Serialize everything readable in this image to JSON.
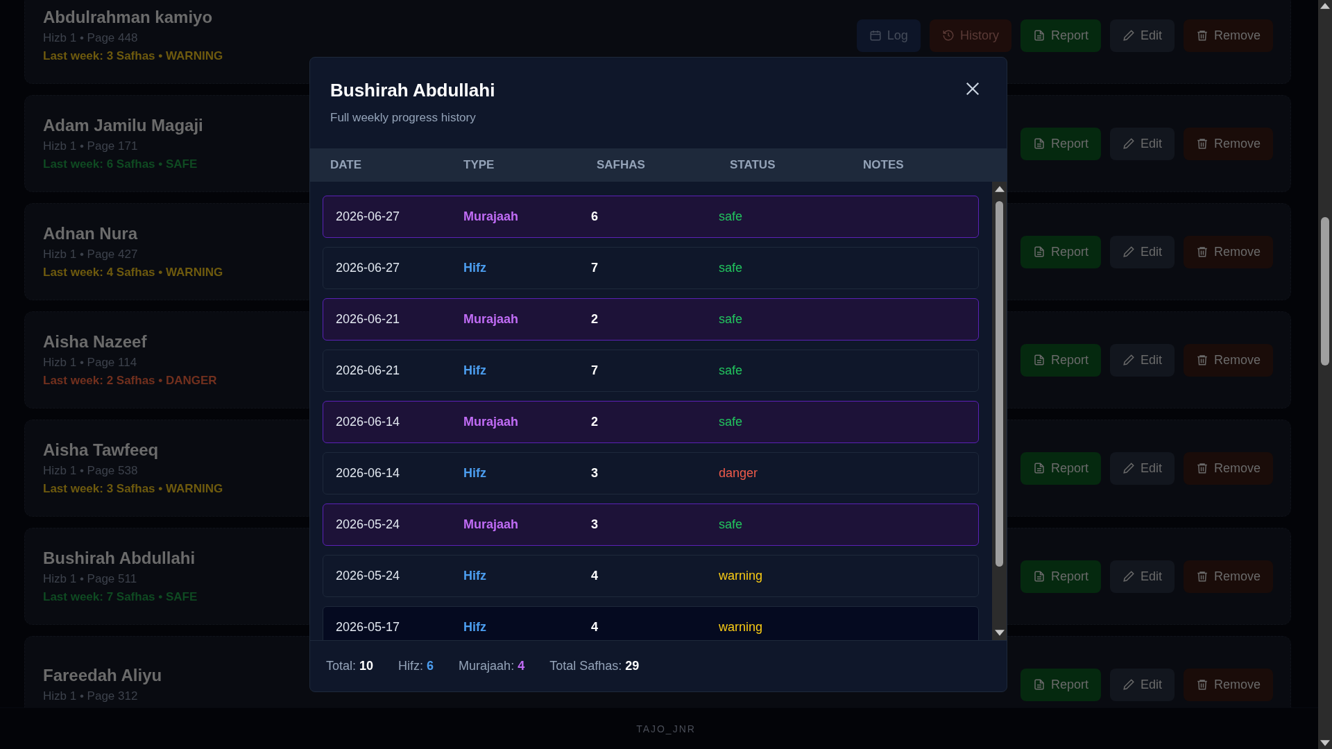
{
  "students": [
    {
      "name": "Abdulrahman kamiyo",
      "meta": "Hizb 1 • Page 448",
      "last_week": "Last week: 3 Safhas • WARNING",
      "color": "#6e5a0e",
      "buttons": [
        {
          "kind": "log",
          "label": "Log"
        },
        {
          "kind": "history",
          "label": "History"
        },
        {
          "kind": "report",
          "label": "Report"
        },
        {
          "kind": "edit",
          "label": "Edit"
        },
        {
          "kind": "remove",
          "label": "Remove"
        }
      ]
    },
    {
      "name": "Adam Jamilu Magaji",
      "meta": "Hizb 1 • Page 171",
      "last_week": "Last week: 6 Safhas • SAFE",
      "color": "#0f4a22",
      "buttons": [
        {
          "kind": "report",
          "label": "Report"
        },
        {
          "kind": "edit",
          "label": "Edit"
        },
        {
          "kind": "remove",
          "label": "Remove"
        }
      ]
    },
    {
      "name": "Adnan Nura",
      "meta": "Hizb 1 • Page 427",
      "last_week": "Last week: 4 Safhas • WARNING",
      "color": "#6e5a0e",
      "buttons": [
        {
          "kind": "report",
          "label": "Report"
        },
        {
          "kind": "edit",
          "label": "Edit"
        },
        {
          "kind": "remove",
          "label": "Remove"
        }
      ]
    },
    {
      "name": "Aisha Nazeef",
      "meta": "Hizb 1 • Page 114",
      "last_week": "Last week: 2 Safhas • DANGER",
      "color": "#72301e",
      "buttons": [
        {
          "kind": "report",
          "label": "Report"
        },
        {
          "kind": "edit",
          "label": "Edit"
        },
        {
          "kind": "remove",
          "label": "Remove"
        }
      ]
    },
    {
      "name": "Aisha Tawfeeq",
      "meta": "Hizb 1 • Page 538",
      "last_week": "Last week: 3 Safhas • WARNING",
      "color": "#6e5a0e",
      "buttons": [
        {
          "kind": "report",
          "label": "Report"
        },
        {
          "kind": "edit",
          "label": "Edit"
        },
        {
          "kind": "remove",
          "label": "Remove"
        }
      ]
    },
    {
      "name": "Bushirah Abdullahi",
      "meta": "Hizb 1 • Page 511",
      "last_week": "Last week: 7 Safhas • SAFE",
      "color": "#0f4a22",
      "buttons": [
        {
          "kind": "report",
          "label": "Report"
        },
        {
          "kind": "edit",
          "label": "Edit"
        },
        {
          "kind": "remove",
          "label": "Remove"
        }
      ]
    },
    {
      "name": "Fareedah Aliyu",
      "meta": "Hizb 1 • Page 312",
      "buttons": [
        {
          "kind": "report",
          "label": "Report"
        },
        {
          "kind": "edit",
          "label": "Edit"
        },
        {
          "kind": "remove",
          "label": "Remove"
        }
      ]
    }
  ],
  "footer": "TAJO_JNR",
  "modal": {
    "title": "Bushirah Abdullahi",
    "subtitle": "Full weekly progress history",
    "columns": [
      "DATE",
      "TYPE",
      "SAFHAS",
      "STATUS",
      "NOTES"
    ],
    "rows": [
      {
        "date": "2026-06-27",
        "type": "Murajaah",
        "kind": "murajaah",
        "safhas": "6",
        "status": "safe",
        "color": "#22c55e",
        "highlighted": false
      },
      {
        "date": "2026-06-27",
        "type": "Hifz",
        "kind": "hifz",
        "safhas": "7",
        "status": "safe",
        "color": "#22c55e",
        "highlighted": false
      },
      {
        "date": "2026-06-21",
        "type": "Murajaah",
        "kind": "murajaah",
        "safhas": "2",
        "status": "safe",
        "color": "#22c55e",
        "highlighted": false
      },
      {
        "date": "2026-06-21",
        "type": "Hifz",
        "kind": "hifz",
        "safhas": "7",
        "status": "safe",
        "color": "#22c55e",
        "highlighted": false
      },
      {
        "date": "2026-06-14",
        "type": "Murajaah",
        "kind": "murajaah",
        "safhas": "2",
        "status": "safe",
        "color": "#22c55e",
        "highlighted": false
      },
      {
        "date": "2026-06-14",
        "type": "Hifz",
        "kind": "hifz",
        "safhas": "3",
        "status": "danger",
        "color": "#ef5b4b",
        "highlighted": false
      },
      {
        "date": "2026-05-24",
        "type": "Murajaah",
        "kind": "murajaah",
        "safhas": "3",
        "status": "safe",
        "color": "#22c55e",
        "highlighted": false
      },
      {
        "date": "2026-05-24",
        "type": "Hifz",
        "kind": "hifz",
        "safhas": "4",
        "status": "warning",
        "color": "#facc15",
        "highlighted": false
      },
      {
        "date": "2026-05-17",
        "type": "Hifz",
        "kind": "hifz",
        "safhas": "4",
        "status": "warning",
        "color": "#facc15",
        "highlighted": true
      }
    ],
    "stats": [
      {
        "label": "Total:",
        "value": "10",
        "color": "#ffffff"
      },
      {
        "label": "Hifz:",
        "value": "6",
        "color": "#4c9ef0"
      },
      {
        "label": "Murajaah:",
        "value": "4",
        "color": "#c06cf5"
      },
      {
        "label": "Total Safhas:",
        "value": "29",
        "color": "#ffffff"
      }
    ]
  }
}
